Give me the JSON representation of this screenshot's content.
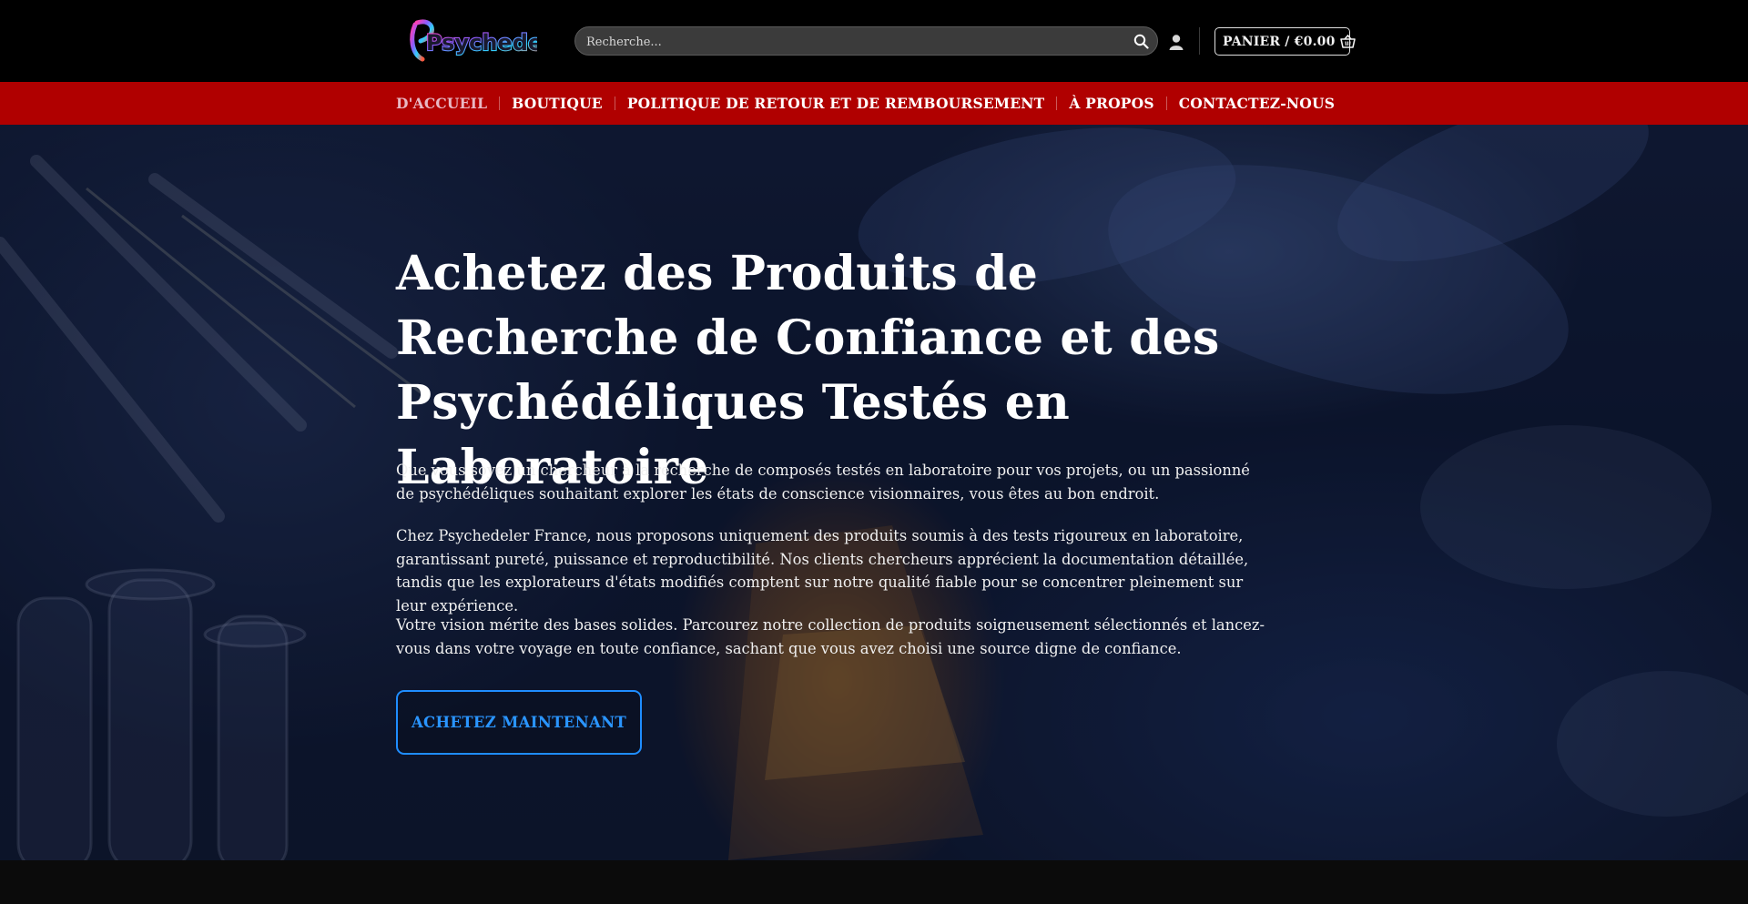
{
  "header": {
    "logo_text": "Psychedeli",
    "search": {
      "placeholder": "Recherche...",
      "value": ""
    },
    "search_icon": "search-icon",
    "account_icon": "user-icon",
    "cart": {
      "label": "PANIER / €0.00",
      "icon": "basket-icon"
    }
  },
  "nav": {
    "items": [
      {
        "label": "D'ACCUEIL",
        "active": true
      },
      {
        "label": "BOUTIQUE",
        "active": false
      },
      {
        "label": "POLITIQUE DE RETOUR ET DE REMBOURSEMENT",
        "active": false
      },
      {
        "label": "À PROPOS",
        "active": false
      },
      {
        "label": "CONTACTEZ-NOUS",
        "active": false
      }
    ]
  },
  "hero": {
    "title": "Achetez des Produits de Recherche de Confiance et des Psychédéliques Testés en Laboratoire",
    "paragraphs": [
      "Que vous soyez un chercheur à la recherche de composés testés en laboratoire pour vos projets, ou un passionné de psychédéliques souhaitant explorer les états de conscience visionnaires, vous êtes au bon endroit.",
      "Chez Psychedeler France, nous proposons uniquement des produits soumis à des tests rigoureux en laboratoire, garantissant pureté, puissance et reproductibilité. Nos clients chercheurs apprécient la documentation détaillée, tandis que les explorateurs d'états modifiés comptent sur notre qualité fiable pour se concentrer pleinement sur leur expérience.",
      "Votre vision mérite des bases solides. Parcourez notre collection de produits soigneusement sélectionnés et lancez-vous dans votre voyage en toute confiance, sachant que vous avez choisi une source digne de confiance."
    ],
    "cta_label": "ACHETEZ MAINTENANT"
  },
  "colors": {
    "topbar": "#000000",
    "navbar": "#b00000",
    "nav_active": "#e9b8c4",
    "cta_accent": "#1f8dff"
  }
}
